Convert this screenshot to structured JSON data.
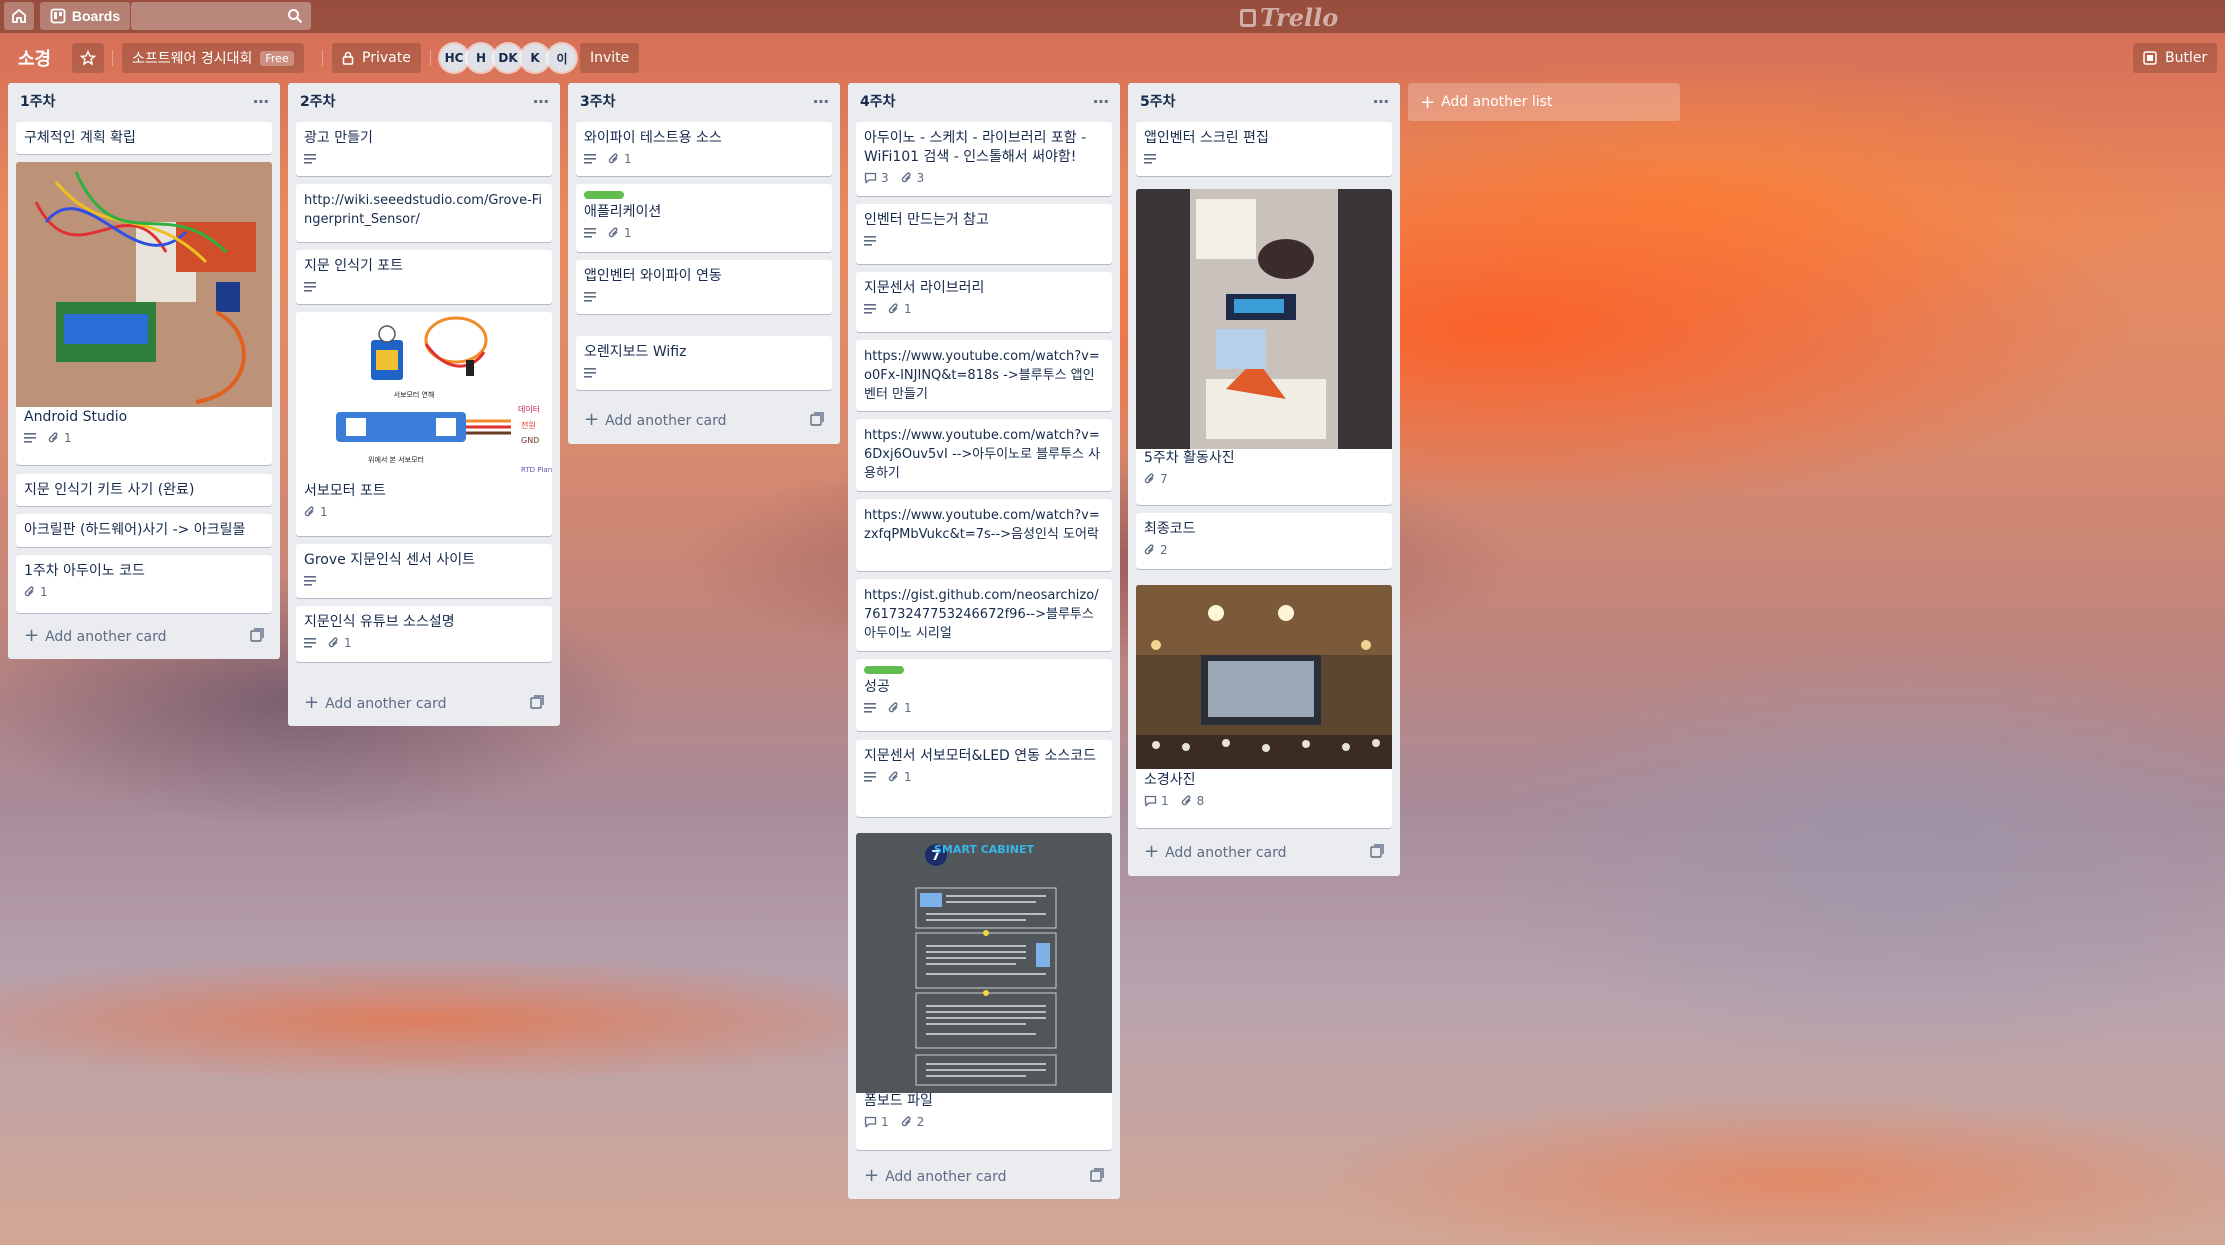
{
  "header": {
    "boards_label": "Boards",
    "logo_text": "Trello"
  },
  "board": {
    "title": "소경",
    "team_name": "소프트웨어 경시대회",
    "team_badge": "Free",
    "visibility": "Private",
    "members": [
      "HC",
      "H",
      "DK",
      "K",
      "이"
    ],
    "invite_label": "Invite",
    "butler_label": "Butler"
  },
  "lists": [
    {
      "title": "1주차",
      "cards": [
        {
          "title": "구체적인 계획 확립"
        },
        {
          "title": "Android Studio",
          "cover": "arduino-breadboard-photo",
          "description": true,
          "attachments": "1"
        },
        {
          "title": "지문 인식기 키트 사기 (완료)"
        },
        {
          "title": "아크릴판 (하드웨어)사기 -> 아크릴몰"
        },
        {
          "title": "1주차 아두이노 코드",
          "attachments": "1"
        }
      ],
      "add_card": "Add another card"
    },
    {
      "title": "2주차",
      "cards": [
        {
          "title": "광고 만들기",
          "description": true
        },
        {
          "title": "http://wiki.seeedstudio.com/Grove-Fingerprint_Sensor/"
        },
        {
          "title": "지문 인식기 포트",
          "description": true
        },
        {
          "title": "서보모터 포트",
          "cover": "servo-motor-diagram",
          "attachments": "1",
          "cover_labels": {
            "top": "서보모터 연해",
            "signal": "데이터",
            "power": "전원",
            "ground": "GND",
            "bottom": "위에서 본 서보모터",
            "brand": "RTD Planet"
          }
        },
        {
          "title": "Grove 지문인식 센서 사이트",
          "description": true
        },
        {
          "title": "지문인식 유튜브 소스설명",
          "description": true,
          "attachments": "1"
        }
      ],
      "add_card": "Add another card"
    },
    {
      "title": "3주차",
      "cards": [
        {
          "title": "와이파이 테스트용 소스",
          "description": true,
          "attachments": "1"
        },
        {
          "title": "애플리케이션",
          "label": "green",
          "description": true,
          "attachments": "1"
        },
        {
          "title": "앱인벤터 와이파이 연동",
          "description": true
        },
        {
          "title": "오렌지보드 Wifiz",
          "description": true
        }
      ],
      "add_card": "Add another card"
    },
    {
      "title": "4주차",
      "cards": [
        {
          "title": "아두이노 - 스케치 - 라이브러리 포함 - WiFi101 검색 - 인스톨해서 써야함!",
          "comments": "3",
          "attachments": "3"
        },
        {
          "title": "인벤터 만드는거 참고",
          "description": true
        },
        {
          "title": "지문센서 라이브러리",
          "description": true,
          "attachments": "1"
        },
        {
          "title": "https://www.youtube.com/watch?v=o0Fx-INJINQ&t=818s ->블루투스 앱인벤터 만들기"
        },
        {
          "title": "https://www.youtube.com/watch?v=6Dxj6Ouv5vI -->아두이노로 블루투스 사용하기"
        },
        {
          "title": "https://www.youtube.com/watch?v=zxfqPMbVukc&t=7s-->음성인식 도어락"
        },
        {
          "title": "https://gist.github.com/neosarchizo/76173247753246672f96-->블루투스 아두이노 시리얼"
        },
        {
          "title": "성공",
          "label": "green",
          "description": true,
          "attachments": "1"
        },
        {
          "title": "지문센서 서보모터&LED 연동 소스코드",
          "description": true,
          "attachments": "1"
        },
        {
          "title": "폼보드 파일",
          "cover": "smart-cabinet-poster",
          "comments": "1",
          "attachments": "2",
          "cover_labels": {
            "number": "7",
            "heading": "SMART CABINET"
          }
        }
      ],
      "add_card": "Add another card"
    },
    {
      "title": "5주차",
      "cards": [
        {
          "title": "앱인벤터 스크린 편집",
          "description": true
        },
        {
          "title": "5주차 활동사진",
          "cover": "activity-photo",
          "attachments": "7"
        },
        {
          "title": "최종코드",
          "attachments": "2"
        },
        {
          "title": "소경사진",
          "cover": "presentation-hall-photo",
          "comments": "1",
          "attachments": "8"
        }
      ],
      "add_card": "Add another card"
    }
  ],
  "add_list_label": "Add another list",
  "colors": {
    "list_bg": "#ebecf0",
    "card_bg": "#ffffff",
    "label_green": "#61bd4f",
    "text_primary": "#172b4d",
    "text_muted": "#5e6c84"
  }
}
